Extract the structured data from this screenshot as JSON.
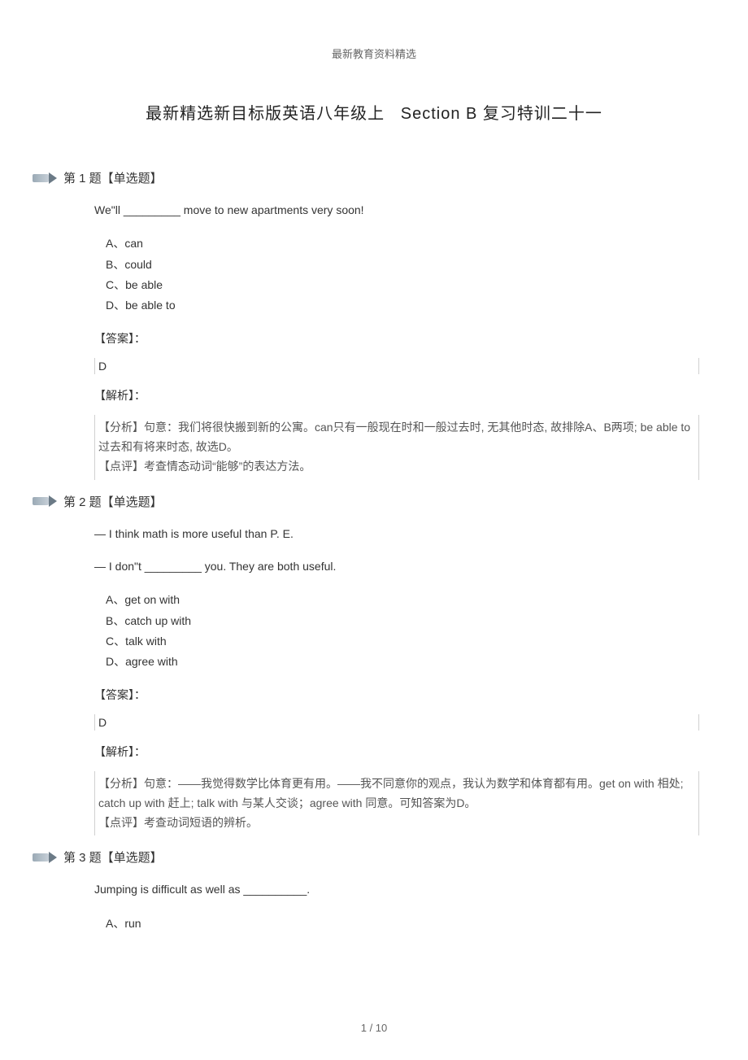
{
  "header": "最新教育资料精选",
  "title_left": "最新精选新目标版英语八年级上",
  "title_right": "Section B 复习特训二十一",
  "questions": [
    {
      "heading": "第 1 题【单选题】",
      "stem": "We\"ll _________ move to new apartments very soon!",
      "options": [
        "A、can",
        "B、could",
        "C、be able",
        "D、be able to"
      ],
      "answer_label": "【答案】：",
      "answer": "D",
      "analysis_label": "【解析】：",
      "analysis_lines": [
        "【分析】句意：我们将很快搬到新的公寓。can只有一般现在时和一般过去时, 无其他时态, 故排除A、B两项; be able to过去和有将来时态, 故选D。",
        "【点评】考查情态动词“能够”的表达方法。"
      ]
    },
    {
      "heading": "第 2 题【单选题】",
      "stems": [
        "— I think math is more useful than P. E.",
        "— I don\"t _________ you. They are both useful."
      ],
      "options": [
        "A、get on with",
        "B、catch up with",
        "C、talk with",
        "D、agree with"
      ],
      "answer_label": "【答案】：",
      "answer": "D",
      "analysis_label": "【解析】：",
      "analysis_lines": [
        "【分析】句意：——我觉得数学比体育更有用。——我不同意你的观点，我认为数学和体育都有用。get on with 相处; catch up with 赶上; talk with 与某人交谈；agree with 同意。可知答案为D。",
        "【点评】考查动词短语的辨析。"
      ]
    },
    {
      "heading": "第 3 题【单选题】",
      "stem": "Jumping is difficult as well as __________.",
      "options_partial": [
        "A、run"
      ]
    }
  ],
  "footer": "1 / 10"
}
